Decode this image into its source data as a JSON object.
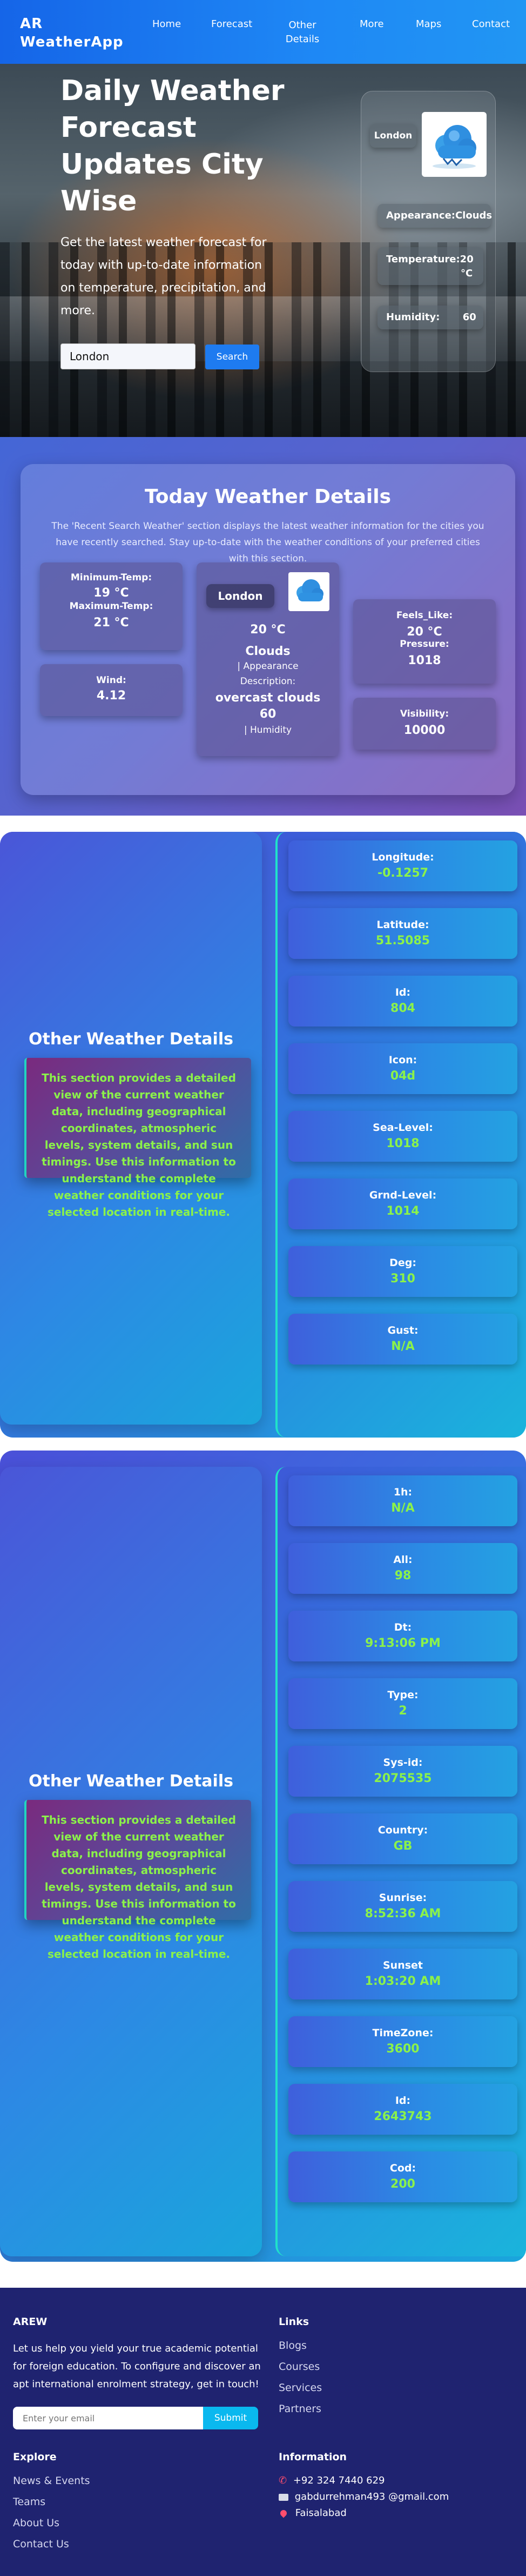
{
  "nav": {
    "brand": "AR\nWeatherApp",
    "links": [
      {
        "label": "Home"
      },
      {
        "label": "Forecast"
      },
      {
        "label": "Other\nDetails"
      },
      {
        "label": "More"
      },
      {
        "label": "Maps"
      },
      {
        "label": "Contact"
      }
    ]
  },
  "hero": {
    "title": "Daily Weather Forecast Updates City Wise",
    "text": "Get the latest weather forecast for today with up-to-date information on temperature, precipitation, and more.",
    "search_value": "London",
    "search_button": "Search",
    "card": {
      "city": "London",
      "appearance": "Appearance:Clouds",
      "temperature_label": "Temperature:20",
      "temperature_unit": "°C",
      "humidity_label": "Humidity:",
      "humidity_value": "60"
    }
  },
  "today": {
    "title": "Today Weather Details",
    "subtitle": "The 'Recent Search Weather' section displays the latest weather information for the cities you have recently searched. Stay up-to-date with the weather conditions of your preferred cities with this section.",
    "min_temp_label": "Minimum-Temp:",
    "min_temp_value": "19 °C",
    "max_temp_label": "Maximum-Temp:",
    "max_temp_value": "21 °C",
    "wind_label": "Wind:",
    "wind_value": "4.12",
    "city": "London",
    "temp": "20 °C",
    "appearance_value": "Clouds",
    "appearance_label": "| Appearance",
    "description_label": "Description:",
    "description_value": "overcast clouds",
    "humidity_value": "60",
    "humidity_label": "| Humidity",
    "feels_like_label": "Feels_Like:",
    "feels_like_value": "20 °C",
    "pressure_label": "Pressure:",
    "pressure_value": "1018",
    "visibility_label": "Visibility:",
    "visibility_value": "10000"
  },
  "details1": {
    "heading": "Other Weather Details",
    "description": "This section provides a detailed view of the current weather data, including geographical coordinates, atmospheric levels, system details, and sun timings. Use this information to understand the complete weather conditions for your selected location in real-time.",
    "items": [
      {
        "label": "Longitude:",
        "value": "-0.1257"
      },
      {
        "label": "Latitude:",
        "value": "51.5085"
      },
      {
        "label": "Id:",
        "value": "804"
      },
      {
        "label": "Icon:",
        "value": "04d"
      },
      {
        "label": "Sea-Level:",
        "value": "1018"
      },
      {
        "label": "Grnd-Level:",
        "value": "1014"
      },
      {
        "label": "Deg:",
        "value": "310"
      },
      {
        "label": "Gust:",
        "value": "N/A"
      }
    ]
  },
  "details2": {
    "heading": "Other Weather Details",
    "description": "This section provides a detailed view of the current weather data, including geographical coordinates, atmospheric levels, system details, and sun timings. Use this information to understand the complete weather conditions for your selected location in real-time.",
    "items": [
      {
        "label": "1h:",
        "value": "N/A"
      },
      {
        "label": "All:",
        "value": "98"
      },
      {
        "label": "Dt:",
        "value": "9:13:06 PM"
      },
      {
        "label": "Type:",
        "value": "2"
      },
      {
        "label": "Sys-id:",
        "value": "2075535"
      },
      {
        "label": "Country:",
        "value": "GB"
      },
      {
        "label": "Sunrise:",
        "value": "8:52:36 AM"
      },
      {
        "label": "Sunset",
        "value": "1:03:20 AM"
      },
      {
        "label": "TimeZone:",
        "value": "3600"
      },
      {
        "label": "Id:",
        "value": "2643743"
      },
      {
        "label": "Cod:",
        "value": "200"
      }
    ]
  },
  "footer": {
    "brand": "AREW",
    "about": "Let us help you yield your true academic potential for foreign education. To configure and discover an apt international enrolment strategy, get in touch!",
    "email_placeholder": "Enter your email",
    "submit": "Submit",
    "links_heading": "Links",
    "links": [
      "Blogs",
      "Courses",
      "Services",
      "Partners"
    ],
    "explore_heading": "Explore",
    "explore": [
      "News & Events",
      "Teams",
      "About Us",
      "Contact Us"
    ],
    "info_heading": "Information",
    "phone": "+92 324 7440 629",
    "email": "gabdurrehman493 @gmail.com",
    "location": "Faisalabad"
  },
  "colors": {
    "nav": "#1e88f5",
    "accent_green": "#8bf24a",
    "footer": "#1f2370",
    "search_button": "#1e7bf0"
  }
}
